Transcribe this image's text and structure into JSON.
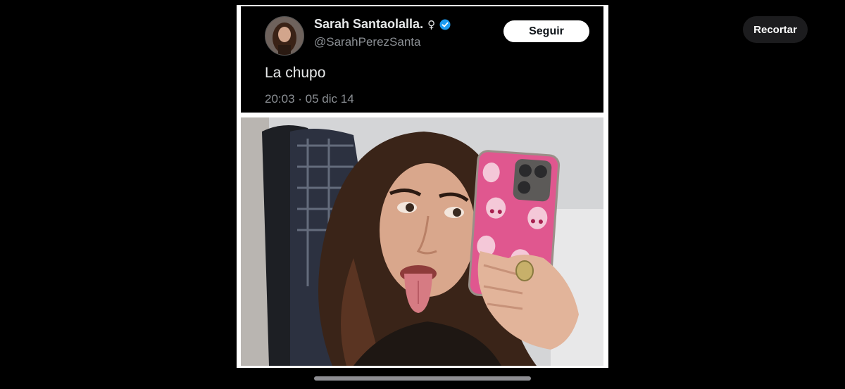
{
  "toolbar": {
    "crop_label": "Recortar"
  },
  "tweet": {
    "display_name": "Sarah Santaolalla.",
    "gender_symbol": "♀",
    "handle": "@SarahPerezSanta",
    "follow_label": "Seguir",
    "text": "La chupo",
    "timestamp": "20:03 · 05 dic 14",
    "verified_color": "#1d9bf0"
  },
  "colors": {
    "background": "#000000",
    "tweet_background": "#000000",
    "phone_case": "#e0578f"
  }
}
